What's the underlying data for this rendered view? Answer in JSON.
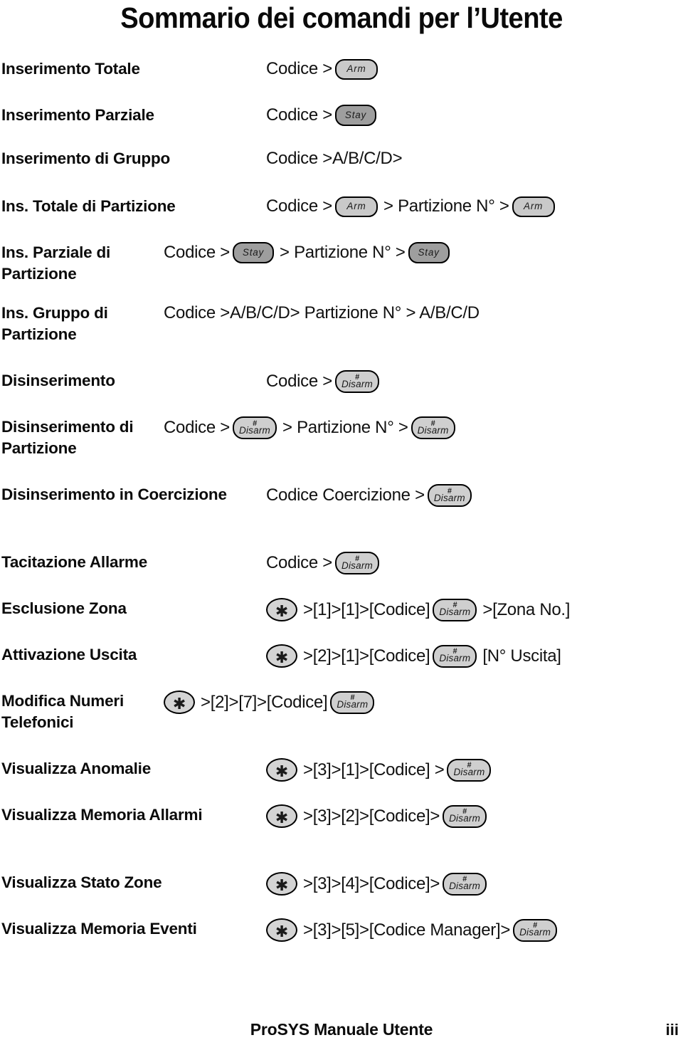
{
  "document": {
    "title": "Sommario dei comandi per l’Utente",
    "footer_title": "ProSYS Manuale Utente",
    "footer_page": "iii"
  },
  "keys": {
    "arm": {
      "label": "Arm",
      "color": "#c9c9c9"
    },
    "stay": {
      "label": "Stay",
      "color": "#9e9e9e"
    },
    "disarm": {
      "label": "Disarm",
      "hash": "#",
      "color": "#cfcfcf"
    },
    "star": {
      "label": "✱",
      "color": "#d4d4d4"
    }
  },
  "rows": [
    {
      "label": "Inserimento Totale",
      "seq": [
        {
          "type": "text",
          "value": "Codice >"
        },
        {
          "type": "key",
          "key": "arm"
        }
      ]
    },
    {
      "label": "Inserimento Parziale",
      "seq": [
        {
          "type": "text",
          "value": "Codice >"
        },
        {
          "type": "key",
          "key": "stay"
        }
      ]
    },
    {
      "label": "Inserimento di Gruppo",
      "seq": [
        {
          "type": "text",
          "value": "Codice >A/B/C/D>"
        }
      ]
    },
    {
      "label": "Ins. Totale di Partizione",
      "seq": [
        {
          "type": "text",
          "value": "Codice >"
        },
        {
          "type": "key",
          "key": "arm"
        },
        {
          "type": "text",
          "value": "> Partizione N° >"
        },
        {
          "type": "key",
          "key": "arm"
        }
      ]
    },
    {
      "label": "Ins. Parziale di Partizione",
      "seq": [
        {
          "type": "text",
          "value": "Codice >"
        },
        {
          "type": "key",
          "key": "stay"
        },
        {
          "type": "text",
          "value": "> Partizione N° >"
        },
        {
          "type": "key",
          "key": "stay"
        }
      ]
    },
    {
      "label": "Ins. Gruppo di Partizione",
      "seq": [
        {
          "type": "text",
          "value": "Codice >A/B/C/D> Partizione N° > A/B/C/D"
        }
      ]
    },
    {
      "label": "Disinserimento",
      "seq": [
        {
          "type": "text",
          "value": "Codice >"
        },
        {
          "type": "key",
          "key": "disarm"
        }
      ]
    },
    {
      "label": "Disinserimento di Partizione",
      "seq": [
        {
          "type": "text",
          "value": "Codice >"
        },
        {
          "type": "key",
          "key": "disarm"
        },
        {
          "type": "text",
          "value": "> Partizione N° >"
        },
        {
          "type": "key",
          "key": "disarm"
        }
      ]
    },
    {
      "label": "Disinserimento in Coercizione",
      "seq": [
        {
          "type": "text",
          "value": "Codice Coercizione >"
        },
        {
          "type": "key",
          "key": "disarm"
        }
      ]
    },
    {
      "label": "Tacitazione Allarme",
      "seq": [
        {
          "type": "text",
          "value": "Codice >"
        },
        {
          "type": "key",
          "key": "disarm"
        }
      ]
    },
    {
      "label": "Esclusione Zona",
      "seq": [
        {
          "type": "key",
          "key": "star"
        },
        {
          "type": "text",
          "value": ">[1]>[1]>[Codice]"
        },
        {
          "type": "key",
          "key": "disarm"
        },
        {
          "type": "text",
          "value": ">[Zona No.]"
        }
      ]
    },
    {
      "label": "Attivazione Uscita",
      "seq": [
        {
          "type": "key",
          "key": "star"
        },
        {
          "type": "text",
          "value": ">[2]>[1]>[Codice]"
        },
        {
          "type": "key",
          "key": "disarm"
        },
        {
          "type": "text",
          "value": "[N° Uscita]"
        }
      ]
    },
    {
      "label": "Modifica Numeri Telefonici",
      "seq": [
        {
          "type": "key",
          "key": "star"
        },
        {
          "type": "text",
          "value": ">[2]>[7]>[Codice]"
        },
        {
          "type": "key",
          "key": "disarm"
        }
      ]
    },
    {
      "label": "Visualizza Anomalie",
      "seq": [
        {
          "type": "key",
          "key": "star"
        },
        {
          "type": "text",
          "value": ">[3]>[1]>[Codice] >"
        },
        {
          "type": "key",
          "key": "disarm"
        }
      ]
    },
    {
      "label": "Visualizza Memoria Allarmi",
      "seq": [
        {
          "type": "key",
          "key": "star"
        },
        {
          "type": "text",
          "value": ">[3]>[2]>[Codice]>"
        },
        {
          "type": "key",
          "key": "disarm"
        }
      ]
    },
    {
      "label": "Visualizza Stato Zone",
      "seq": [
        {
          "type": "key",
          "key": "star"
        },
        {
          "type": "text",
          "value": ">[3]>[4]>[Codice]>"
        },
        {
          "type": "key",
          "key": "disarm"
        }
      ]
    },
    {
      "label": "Visualizza Memoria Eventi",
      "seq": [
        {
          "type": "key",
          "key": "star"
        },
        {
          "type": "text",
          "value": ">[3]>[5]>[Codice Manager]>"
        },
        {
          "type": "key",
          "key": "disarm"
        }
      ]
    }
  ],
  "layout": {
    "row_tops": [
      12,
      77,
      138,
      205,
      270,
      355,
      450,
      515,
      610,
      705,
      770,
      835,
      900,
      995,
      1060,
      1155,
      1220
    ],
    "label_widths": [
      374,
      374,
      374,
      374,
      230,
      230,
      374,
      230,
      374,
      374,
      374,
      374,
      230,
      374,
      374,
      374,
      374
    ]
  }
}
